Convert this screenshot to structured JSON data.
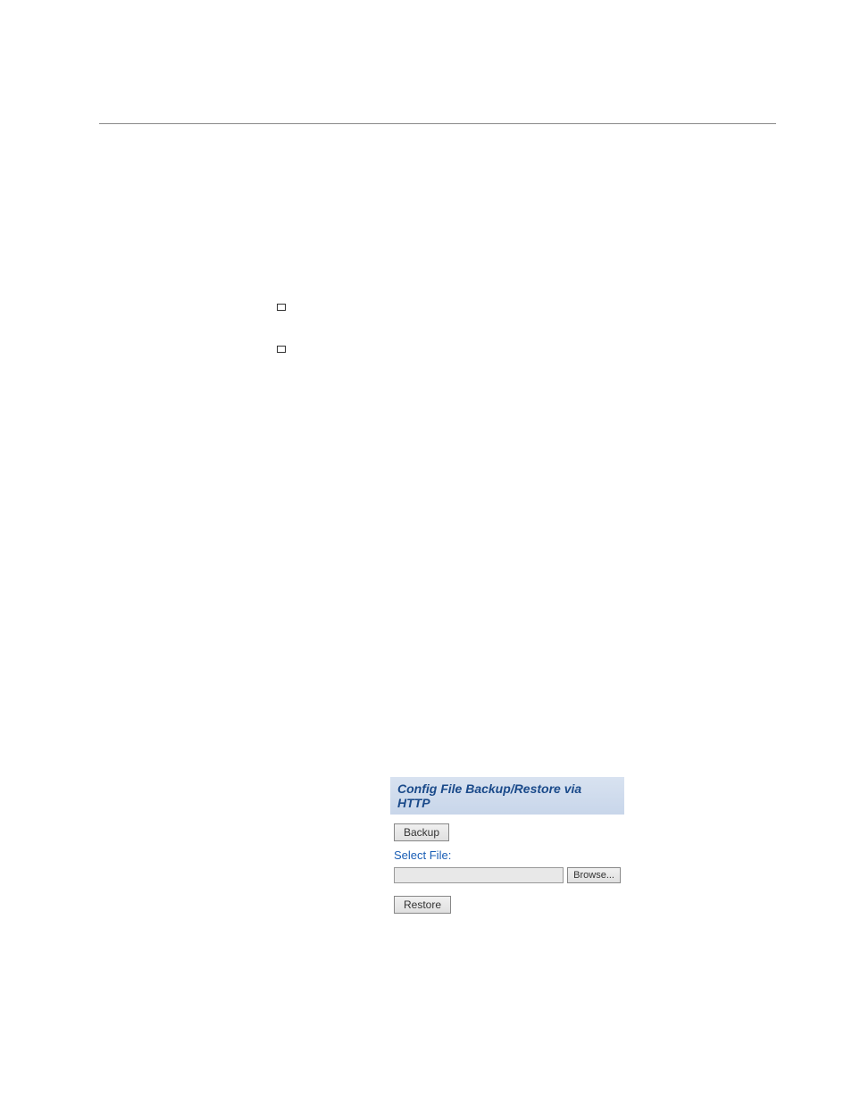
{
  "panel": {
    "title": "Config File Backup/Restore via HTTP",
    "backup_label": "Backup",
    "select_file_label": "Select File:",
    "browse_label": "Browse...",
    "restore_label": "Restore",
    "file_value": ""
  }
}
